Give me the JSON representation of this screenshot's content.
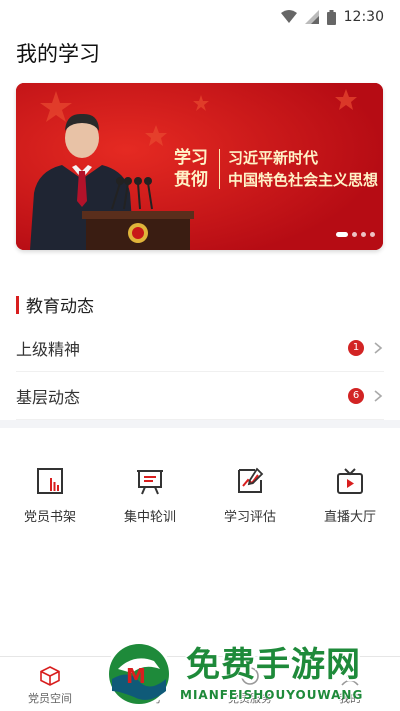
{
  "status_bar": {
    "time": "12:30"
  },
  "page": {
    "title": "我的学习"
  },
  "banner": {
    "text_left_line1": "学习",
    "text_left_line2": "贯彻",
    "text_right_line1": "习近平新时代",
    "text_right_line2": "中国特色社会主义思想",
    "slide_count": 4,
    "active_slide": 1
  },
  "section": {
    "title": "教育动态",
    "items": [
      {
        "label": "上级精神",
        "badge": "1"
      },
      {
        "label": "基层动态",
        "badge": "6"
      }
    ]
  },
  "grid": [
    {
      "label": "党员书架",
      "icon": "bookshelf-icon"
    },
    {
      "label": "集中轮训",
      "icon": "presentation-board-icon"
    },
    {
      "label": "学习评估",
      "icon": "evaluation-chart-icon"
    },
    {
      "label": "直播大厅",
      "icon": "live-tv-icon"
    }
  ],
  "tabs": [
    {
      "label": "党员空间",
      "icon": "cube-icon"
    },
    {
      "label": "学习",
      "icon": "study-icon"
    },
    {
      "label": "党员服务",
      "icon": "service-icon"
    },
    {
      "label": "我的",
      "icon": "profile-icon"
    }
  ],
  "watermark": {
    "text": "免费手游网",
    "sub": "MIANFEISHOUYOUWANG"
  },
  "colors": {
    "accent": "#d81e1e",
    "banner_red": "#cf121a",
    "watermark_green": "#1e8a3a"
  }
}
